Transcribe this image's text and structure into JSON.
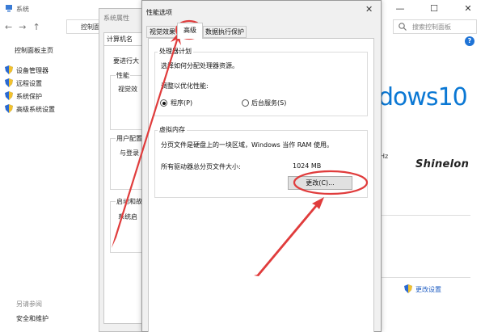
{
  "system_window": {
    "title": "系统",
    "controls": [
      "—",
      "☐",
      "✕"
    ],
    "nav_arrows": [
      "←",
      "→",
      "↑"
    ],
    "address": "控制面",
    "search_placeholder": "搜索控制面板",
    "help": "?",
    "home": "控制面板主页",
    "links": [
      "设备管理器",
      "远程设置",
      "系统保护",
      "高级系统设置"
    ],
    "see_also": "另请参阅",
    "security": "安全和维护",
    "logo_text": "dows10",
    "hz": "Hz",
    "brand": "Shinelon",
    "change_settings": "更改设置"
  },
  "system_properties": {
    "title": "系统属性",
    "tab_computer_name": "计算机名",
    "text_need": "要进行大",
    "performance": "性能",
    "visual_partial": "视觉效",
    "user_profile": "用户配置",
    "login_partial": "与登录",
    "startup": "启动和故",
    "system_start": "系统启"
  },
  "performance_options": {
    "title": "性能选项",
    "close": "✕",
    "tabs": [
      "视觉效果",
      "高级",
      "数据执行保护"
    ],
    "scheduling": {
      "title": "处理器计划",
      "description": "选择如何分配处理器资源。",
      "adjust_label": "调整以优化性能:",
      "option_programs": "程序(P)",
      "option_services": "后台服务(S)"
    },
    "virtual_memory": {
      "title": "虚拟内存",
      "description": "分页文件是硬盘上的一块区域，Windows 当作 RAM 使用。",
      "total_label": "所有驱动器总分页文件大小:",
      "total_value": "1024 MB",
      "change_button": "更改(C)..."
    }
  },
  "colors": {
    "annotation_red": "#e03c3c",
    "link_blue": "#1e5cc2",
    "win10_blue": "#0b78d4"
  }
}
